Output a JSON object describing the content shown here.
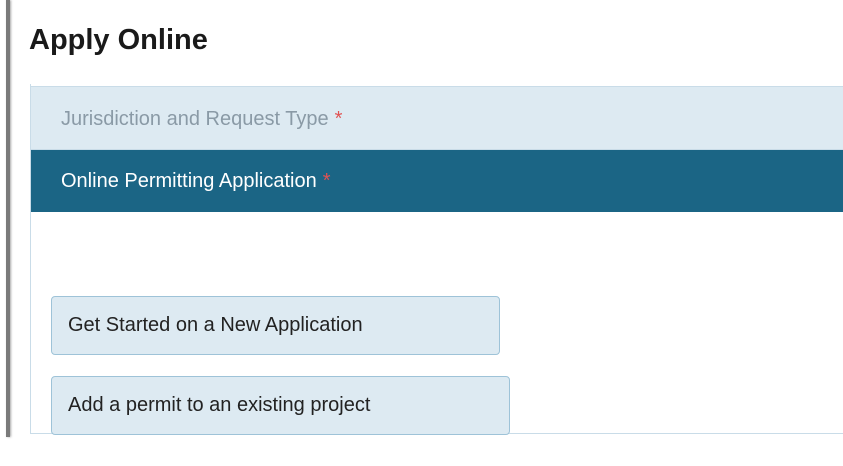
{
  "header": {
    "title": "Apply Online"
  },
  "steps": [
    {
      "label": "Jurisdiction and Request Type",
      "required_mark": "*",
      "active": false
    },
    {
      "label": "Online Permitting Application",
      "required_mark": "*",
      "active": true
    }
  ],
  "actions": {
    "new_application_label": "Get Started on a New Application",
    "add_permit_label": "Add a permit to an existing project"
  },
  "colors": {
    "active_step_bg": "#1b6585",
    "inactive_step_bg": "#ddeaf2",
    "required_mark": "#e05252",
    "button_bg": "#ddeaf2",
    "button_border": "#9ec3d8"
  }
}
